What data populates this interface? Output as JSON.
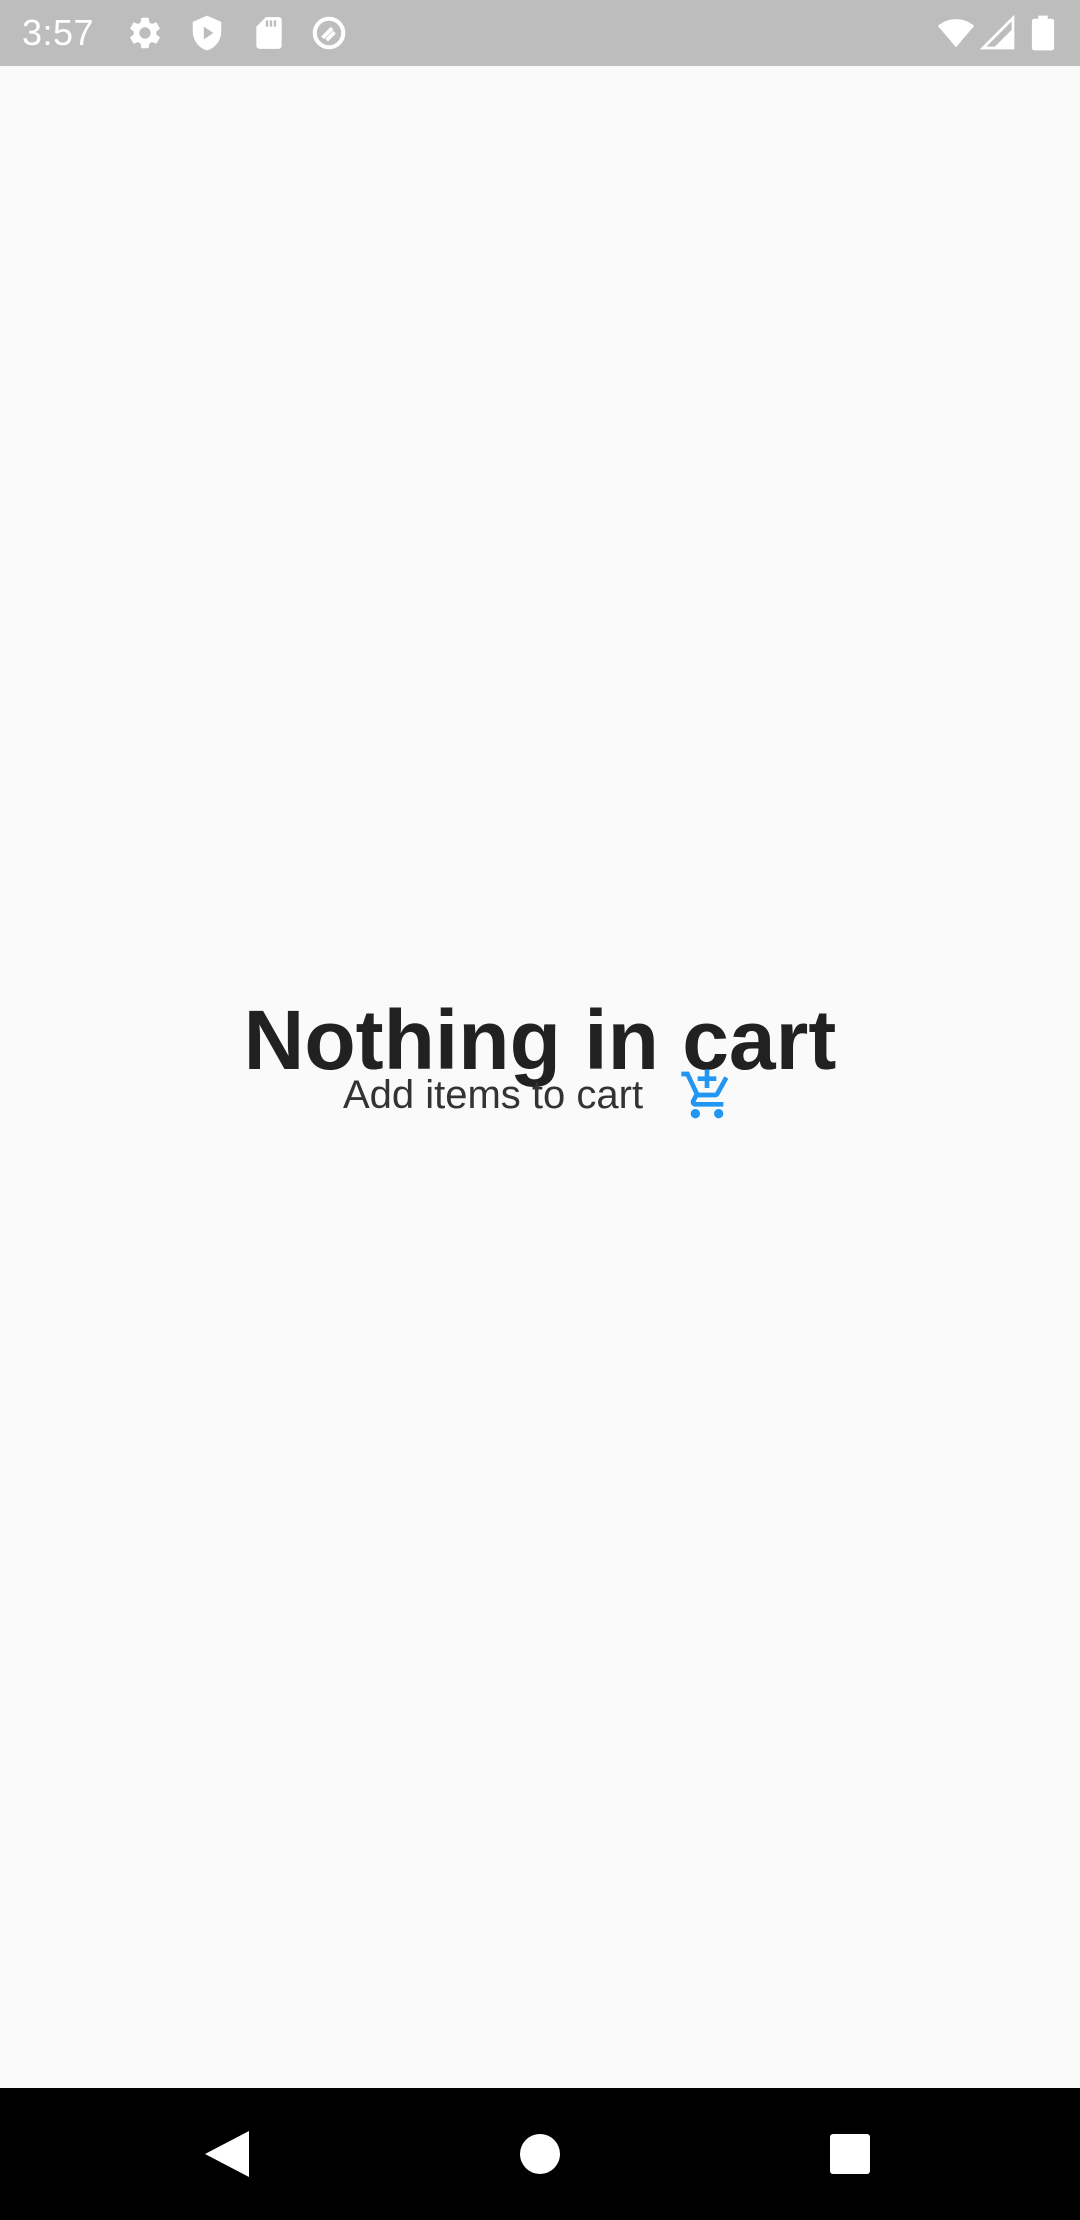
{
  "status_bar": {
    "time": "3:57",
    "left_icons": [
      "gear-icon",
      "shield-play-icon",
      "sd-card-icon",
      "vpn-circle-icon"
    ],
    "right_icons": [
      "wifi-icon",
      "cell-signal-icon",
      "battery-icon"
    ]
  },
  "empty_state": {
    "title": "Nothing in cart",
    "subtitle": "Add items to cart",
    "action_icon": "add-shopping-cart-icon",
    "accent_color": "#2196f3"
  },
  "nav_bar": {
    "buttons": [
      "back-icon",
      "home-icon",
      "recents-icon"
    ]
  }
}
